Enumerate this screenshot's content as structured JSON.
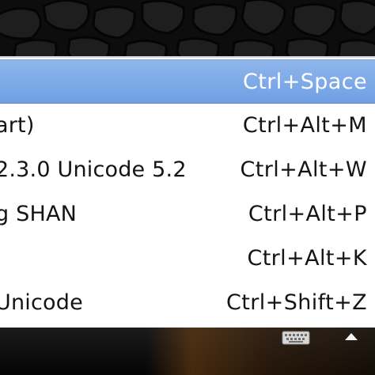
{
  "menu": {
    "items": [
      {
        "label": "",
        "shortcut": "Ctrl+Space",
        "selected": true
      },
      {
        "label": "art)",
        "shortcut": "Ctrl+Alt+M",
        "selected": false
      },
      {
        "label": "2.3.0 Unicode 5.2",
        "shortcut": "Ctrl+Alt+W",
        "selected": false
      },
      {
        "label": "g SHAN",
        "shortcut": "Ctrl+Alt+P",
        "selected": false
      },
      {
        "label": "",
        "shortcut": "Ctrl+Alt+K",
        "selected": false
      },
      {
        "label": "Unicode",
        "shortcut": "Ctrl+Shift+Z",
        "selected": false
      }
    ]
  },
  "taskbar": {
    "icons": [
      "keyboard-icon",
      "tray-arrow-up-icon"
    ]
  },
  "colors": {
    "selection": "#7aa7e8",
    "menu_background": "#ffffff",
    "desktop": "#0d0d0d",
    "text": "#141414"
  }
}
